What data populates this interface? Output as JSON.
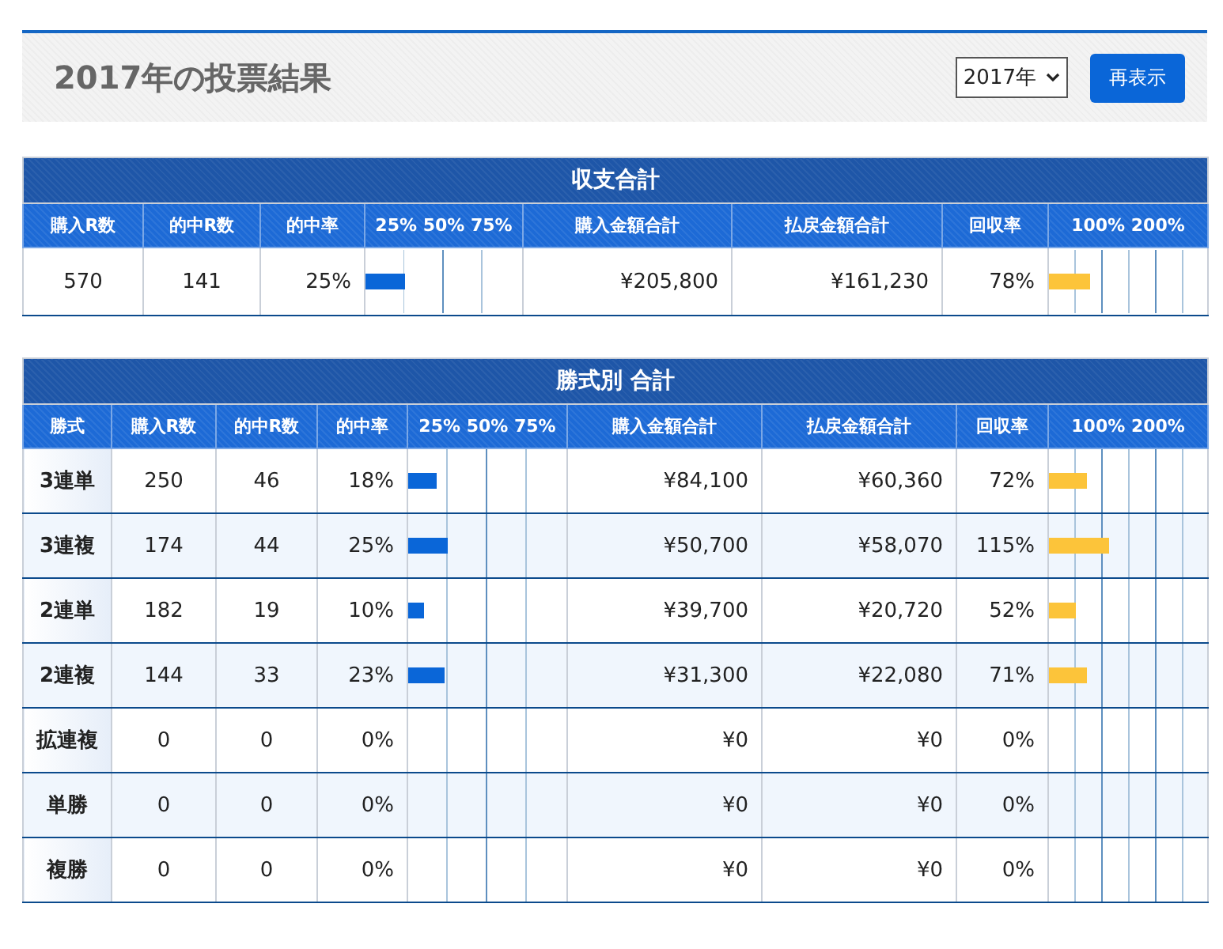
{
  "header": {
    "title": "2017年の投票結果",
    "year_select": {
      "value": "2017年"
    },
    "button": "再表示"
  },
  "summary": {
    "title": "収支合計",
    "columns": [
      "購入R数",
      "的中R数",
      "的中率",
      "25% 50% 75%",
      "購入金額合計",
      "払戻金額合計",
      "回収率",
      "100% 200%"
    ],
    "row": {
      "purchased": "570",
      "hits": "141",
      "hit_rate": "25%",
      "hit_bar": {
        "level": 0.25
      },
      "purchase": "¥205,800",
      "payout": "¥161,230",
      "recovery": "78%",
      "recovery_bar": {
        "level": 0.26
      }
    }
  },
  "by_type": {
    "title": "勝式別 合計",
    "columns": [
      "勝式",
      "購入R数",
      "的中R数",
      "的中率",
      "25% 50% 75%",
      "購入金額合計",
      "払戻金額合計",
      "回収率",
      "100% 200%"
    ],
    "rows": [
      {
        "type": "3連単",
        "purchased": "250",
        "hits": "46",
        "hit_rate": "18%",
        "hit_bar": {
          "level": 0.18
        },
        "purchase": "¥84,100",
        "payout": "¥60,360",
        "recovery": "72%",
        "recovery_bar": {
          "level": 0.24
        }
      },
      {
        "type": "3連複",
        "purchased": "174",
        "hits": "44",
        "hit_rate": "25%",
        "hit_bar": {
          "level": 0.25
        },
        "purchase": "¥50,700",
        "payout": "¥58,070",
        "recovery": "115%",
        "recovery_bar": {
          "level": 0.383
        }
      },
      {
        "type": "2連単",
        "purchased": "182",
        "hits": "19",
        "hit_rate": "10%",
        "hit_bar": {
          "level": 0.1
        },
        "purchase": "¥39,700",
        "payout": "¥20,720",
        "recovery": "52%",
        "recovery_bar": {
          "level": 0.173
        }
      },
      {
        "type": "2連複",
        "purchased": "144",
        "hits": "33",
        "hit_rate": "23%",
        "hit_bar": {
          "level": 0.23
        },
        "purchase": "¥31,300",
        "payout": "¥22,080",
        "recovery": "71%",
        "recovery_bar": {
          "level": 0.237
        }
      },
      {
        "type": "拡連複",
        "purchased": "0",
        "hits": "0",
        "hit_rate": "0%",
        "purchase": "¥0",
        "payout": "¥0",
        "recovery": "0%"
      },
      {
        "type": "単勝",
        "purchased": "0",
        "hits": "0",
        "hit_rate": "0%",
        "purchase": "¥0",
        "payout": "¥0",
        "recovery": "0%"
      },
      {
        "type": "複勝",
        "purchased": "0",
        "hits": "0",
        "hit_rate": "0%",
        "purchase": "¥0",
        "payout": "¥0",
        "recovery": "0%"
      }
    ]
  }
}
